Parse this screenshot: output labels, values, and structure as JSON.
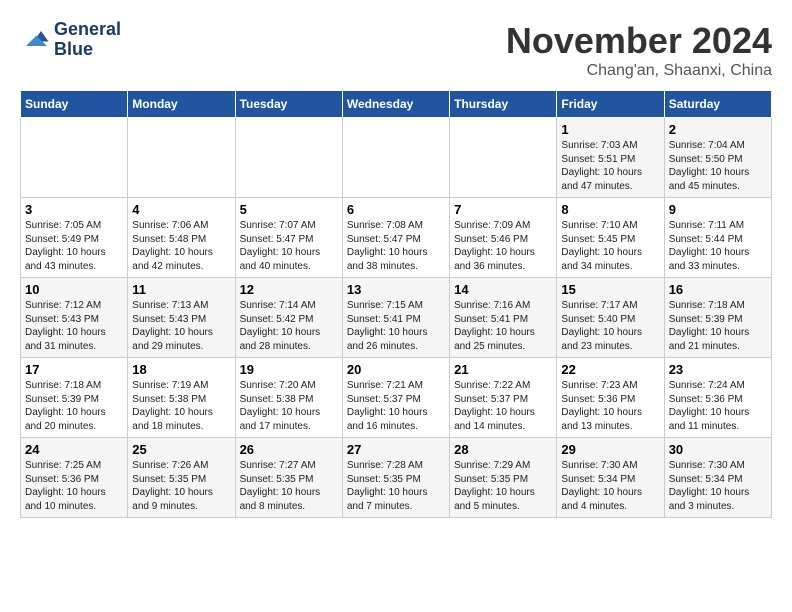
{
  "header": {
    "logo_line1": "General",
    "logo_line2": "Blue",
    "month_title": "November 2024",
    "location": "Chang'an, Shaanxi, China"
  },
  "weekdays": [
    "Sunday",
    "Monday",
    "Tuesday",
    "Wednesday",
    "Thursday",
    "Friday",
    "Saturday"
  ],
  "weeks": [
    [
      {
        "day": "",
        "info": ""
      },
      {
        "day": "",
        "info": ""
      },
      {
        "day": "",
        "info": ""
      },
      {
        "day": "",
        "info": ""
      },
      {
        "day": "",
        "info": ""
      },
      {
        "day": "1",
        "info": "Sunrise: 7:03 AM\nSunset: 5:51 PM\nDaylight: 10 hours\nand 47 minutes."
      },
      {
        "day": "2",
        "info": "Sunrise: 7:04 AM\nSunset: 5:50 PM\nDaylight: 10 hours\nand 45 minutes."
      }
    ],
    [
      {
        "day": "3",
        "info": "Sunrise: 7:05 AM\nSunset: 5:49 PM\nDaylight: 10 hours\nand 43 minutes."
      },
      {
        "day": "4",
        "info": "Sunrise: 7:06 AM\nSunset: 5:48 PM\nDaylight: 10 hours\nand 42 minutes."
      },
      {
        "day": "5",
        "info": "Sunrise: 7:07 AM\nSunset: 5:47 PM\nDaylight: 10 hours\nand 40 minutes."
      },
      {
        "day": "6",
        "info": "Sunrise: 7:08 AM\nSunset: 5:47 PM\nDaylight: 10 hours\nand 38 minutes."
      },
      {
        "day": "7",
        "info": "Sunrise: 7:09 AM\nSunset: 5:46 PM\nDaylight: 10 hours\nand 36 minutes."
      },
      {
        "day": "8",
        "info": "Sunrise: 7:10 AM\nSunset: 5:45 PM\nDaylight: 10 hours\nand 34 minutes."
      },
      {
        "day": "9",
        "info": "Sunrise: 7:11 AM\nSunset: 5:44 PM\nDaylight: 10 hours\nand 33 minutes."
      }
    ],
    [
      {
        "day": "10",
        "info": "Sunrise: 7:12 AM\nSunset: 5:43 PM\nDaylight: 10 hours\nand 31 minutes."
      },
      {
        "day": "11",
        "info": "Sunrise: 7:13 AM\nSunset: 5:43 PM\nDaylight: 10 hours\nand 29 minutes."
      },
      {
        "day": "12",
        "info": "Sunrise: 7:14 AM\nSunset: 5:42 PM\nDaylight: 10 hours\nand 28 minutes."
      },
      {
        "day": "13",
        "info": "Sunrise: 7:15 AM\nSunset: 5:41 PM\nDaylight: 10 hours\nand 26 minutes."
      },
      {
        "day": "14",
        "info": "Sunrise: 7:16 AM\nSunset: 5:41 PM\nDaylight: 10 hours\nand 25 minutes."
      },
      {
        "day": "15",
        "info": "Sunrise: 7:17 AM\nSunset: 5:40 PM\nDaylight: 10 hours\nand 23 minutes."
      },
      {
        "day": "16",
        "info": "Sunrise: 7:18 AM\nSunset: 5:39 PM\nDaylight: 10 hours\nand 21 minutes."
      }
    ],
    [
      {
        "day": "17",
        "info": "Sunrise: 7:18 AM\nSunset: 5:39 PM\nDaylight: 10 hours\nand 20 minutes."
      },
      {
        "day": "18",
        "info": "Sunrise: 7:19 AM\nSunset: 5:38 PM\nDaylight: 10 hours\nand 18 minutes."
      },
      {
        "day": "19",
        "info": "Sunrise: 7:20 AM\nSunset: 5:38 PM\nDaylight: 10 hours\nand 17 minutes."
      },
      {
        "day": "20",
        "info": "Sunrise: 7:21 AM\nSunset: 5:37 PM\nDaylight: 10 hours\nand 16 minutes."
      },
      {
        "day": "21",
        "info": "Sunrise: 7:22 AM\nSunset: 5:37 PM\nDaylight: 10 hours\nand 14 minutes."
      },
      {
        "day": "22",
        "info": "Sunrise: 7:23 AM\nSunset: 5:36 PM\nDaylight: 10 hours\nand 13 minutes."
      },
      {
        "day": "23",
        "info": "Sunrise: 7:24 AM\nSunset: 5:36 PM\nDaylight: 10 hours\nand 11 minutes."
      }
    ],
    [
      {
        "day": "24",
        "info": "Sunrise: 7:25 AM\nSunset: 5:36 PM\nDaylight: 10 hours\nand 10 minutes."
      },
      {
        "day": "25",
        "info": "Sunrise: 7:26 AM\nSunset: 5:35 PM\nDaylight: 10 hours\nand 9 minutes."
      },
      {
        "day": "26",
        "info": "Sunrise: 7:27 AM\nSunset: 5:35 PM\nDaylight: 10 hours\nand 8 minutes."
      },
      {
        "day": "27",
        "info": "Sunrise: 7:28 AM\nSunset: 5:35 PM\nDaylight: 10 hours\nand 7 minutes."
      },
      {
        "day": "28",
        "info": "Sunrise: 7:29 AM\nSunset: 5:35 PM\nDaylight: 10 hours\nand 5 minutes."
      },
      {
        "day": "29",
        "info": "Sunrise: 7:30 AM\nSunset: 5:34 PM\nDaylight: 10 hours\nand 4 minutes."
      },
      {
        "day": "30",
        "info": "Sunrise: 7:30 AM\nSunset: 5:34 PM\nDaylight: 10 hours\nand 3 minutes."
      }
    ]
  ]
}
